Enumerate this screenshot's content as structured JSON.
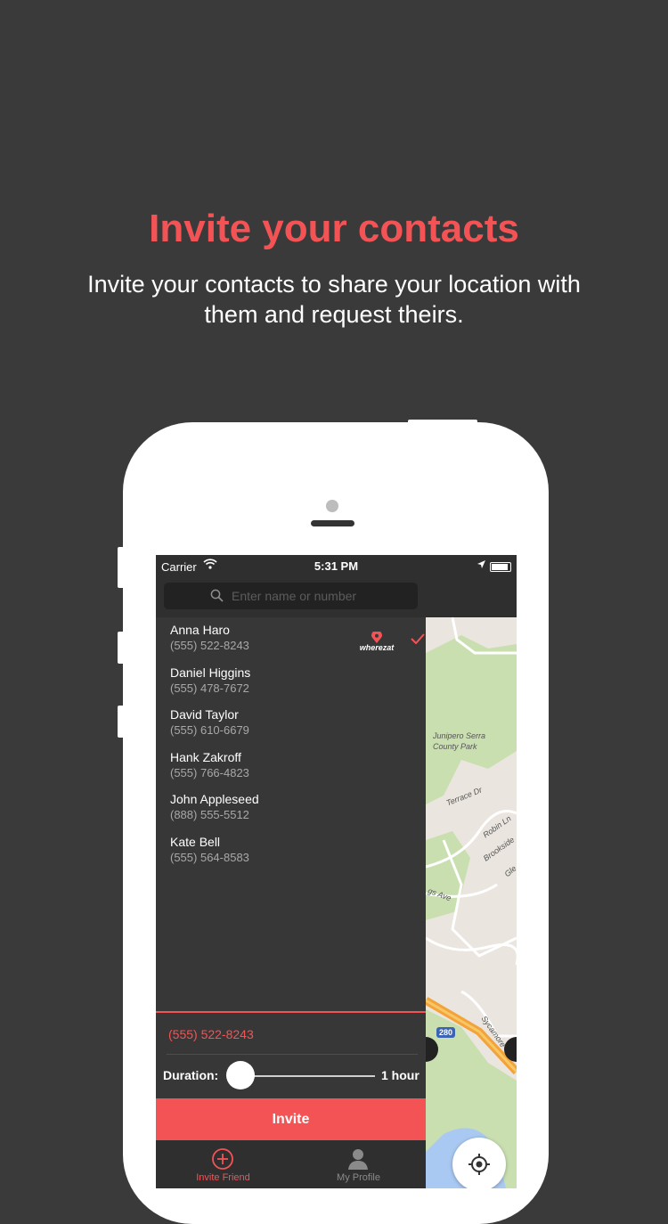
{
  "promo": {
    "title": "Invite your contacts",
    "subtitle": "Invite your contacts to share your location with them and request theirs."
  },
  "statusbar": {
    "carrier": "Carrier",
    "time": "5:31 PM"
  },
  "search": {
    "placeholder": "Enter name or number"
  },
  "brand": {
    "name": "wherezat"
  },
  "contacts": [
    {
      "name": "Anna Haro",
      "phone": "(555) 522-8243",
      "selected": true
    },
    {
      "name": "Daniel Higgins",
      "phone": "(555) 478-7672"
    },
    {
      "name": "David Taylor",
      "phone": "(555) 610-6679"
    },
    {
      "name": "Hank Zakroff",
      "phone": "(555) 766-4823"
    },
    {
      "name": "John Appleseed",
      "phone": "(888) 555-5512"
    },
    {
      "name": "Kate Bell",
      "phone": "(555) 564-8583"
    }
  ],
  "invite_panel": {
    "selected_phone": "(555) 522-8243",
    "duration_label": "Duration:",
    "duration_value": "1 hour",
    "duration_fraction": 0,
    "invite_label": "Invite"
  },
  "tabs": [
    {
      "label": "Invite Friend",
      "icon": "plus-circle-icon",
      "active": true
    },
    {
      "label": "My Profile",
      "icon": "person-icon",
      "active": false
    }
  ],
  "map": {
    "labels": [
      "Junipero Serra",
      "County Park",
      "Terrace Dr",
      "Robin Ln",
      "Brookside",
      "Gle",
      "gs Ave",
      "Sycamore",
      "280"
    ]
  },
  "colors": {
    "accent": "#f45356",
    "background": "#3a3a3a",
    "panel": "#373737",
    "bar": "#2f2f2f",
    "inactive_tab": "#8a8a8a"
  }
}
